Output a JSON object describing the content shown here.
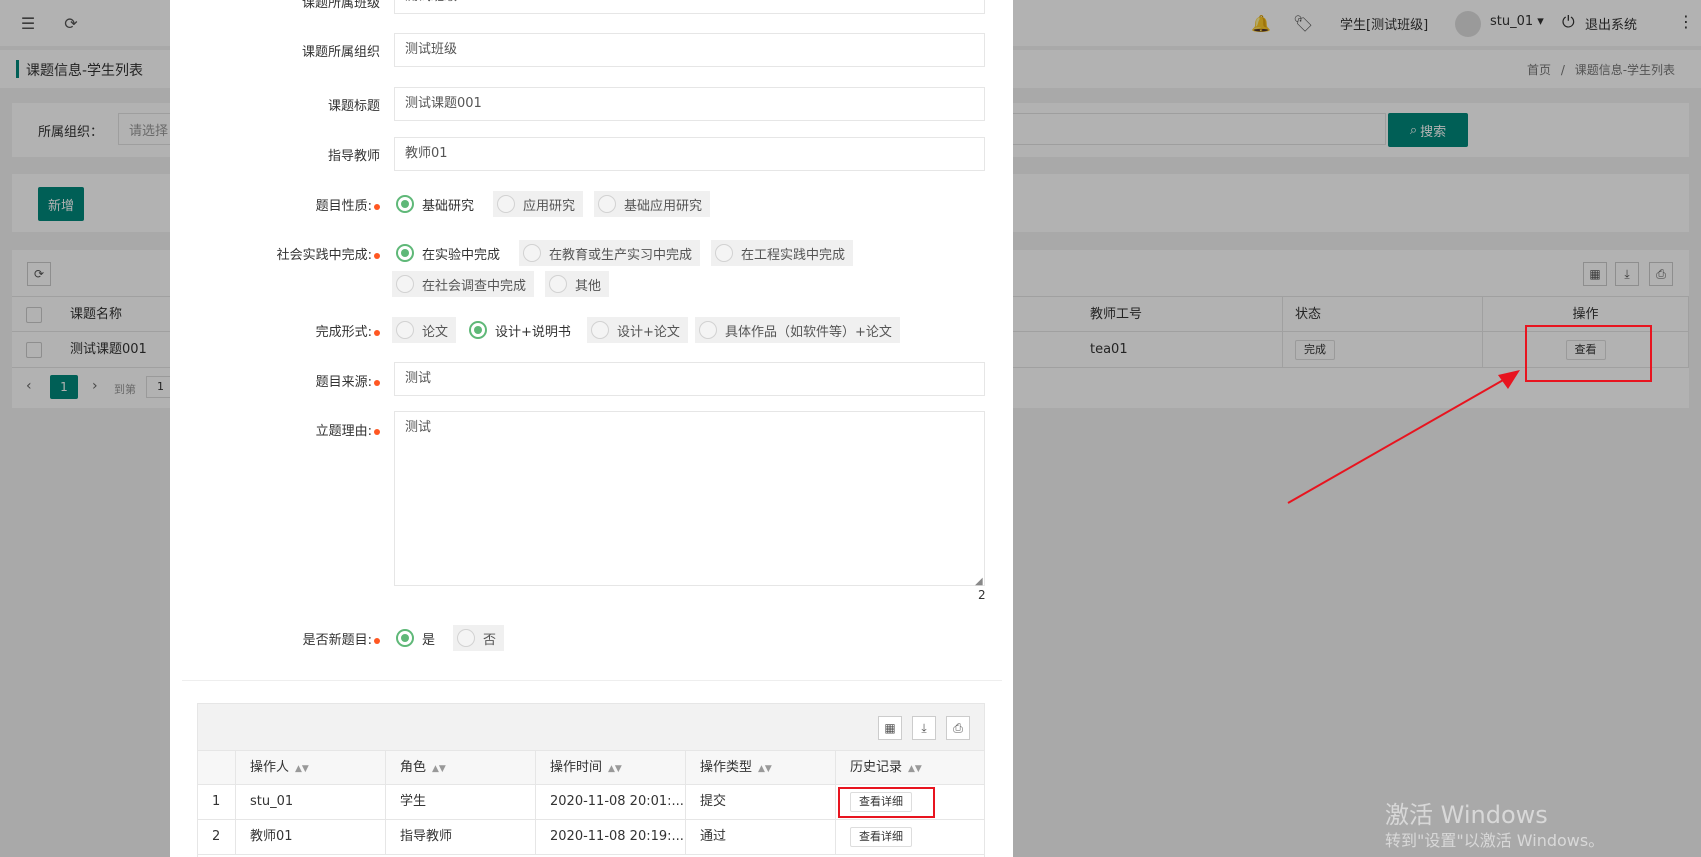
{
  "topbar": {
    "user_org": "学生[测试班级]",
    "username": "stu_01",
    "logout": "退出系统"
  },
  "breadcrumb": {
    "page_title": "课题信息-学生列表",
    "home": "首页",
    "separator": "/",
    "current": "课题信息-学生列表"
  },
  "search": {
    "org_label": "所属组织：",
    "org_placeholder": "请选择",
    "search_button": "搜索"
  },
  "actions": {
    "add_button": "新增"
  },
  "main_table": {
    "headers": [
      "课题名称",
      "教师工号",
      "状态",
      "操作"
    ],
    "row": {
      "name": "测试课题001",
      "teacher_id": "tea01",
      "status": "完成",
      "action": "查看"
    },
    "pagination": {
      "current": "1",
      "goto_label": "到第",
      "goto_value": "1"
    }
  },
  "form": {
    "top_cut_label": "课题所属班级",
    "top_cut_value": "测试班级",
    "org_label": "课题所属组织",
    "org_value": "测试班级",
    "title_label": "课题标题",
    "title_value": "测试课题001",
    "teacher_label": "指导教师",
    "teacher_value": "教师01",
    "nature_label": "题目性质:",
    "nature_options": [
      "基础研究",
      "应用研究",
      "基础应用研究"
    ],
    "practice_label": "社会实践中完成:",
    "practice_options": [
      "在实验中完成",
      "在教育或生产实习中完成",
      "在工程实践中完成",
      "在社会调查中完成",
      "其他"
    ],
    "form_label": "完成形式:",
    "form_options": [
      "论文",
      "设计+说明书",
      "设计+论文",
      "具体作品（如软件等）+论文"
    ],
    "source_label": "题目来源:",
    "source_value": "测试",
    "reason_label": "立题理由:",
    "reason_value": "测试",
    "char_count": "2",
    "new_label": "是否新题目:",
    "new_options": [
      "是",
      "否"
    ]
  },
  "history": {
    "headers": [
      "操作人",
      "角色",
      "操作时间",
      "操作类型",
      "历史记录"
    ],
    "rows": [
      {
        "index": "1",
        "operator": "stu_01",
        "role": "学生",
        "time": "2020-11-08 20:01:...",
        "type": "提交",
        "action": "查看详细"
      },
      {
        "index": "2",
        "operator": "教师01",
        "role": "指导教师",
        "time": "2020-11-08 20:19:...",
        "type": "通过",
        "action": "查看详细"
      }
    ]
  },
  "watermark": {
    "line1": "激活 Windows",
    "line2": "转到\"设置\"以激活 Windows。"
  },
  "colors": {
    "accent": "#00897b",
    "radio_on": "#5fb878",
    "required": "#ff5722",
    "highlight": "#e8141f"
  }
}
